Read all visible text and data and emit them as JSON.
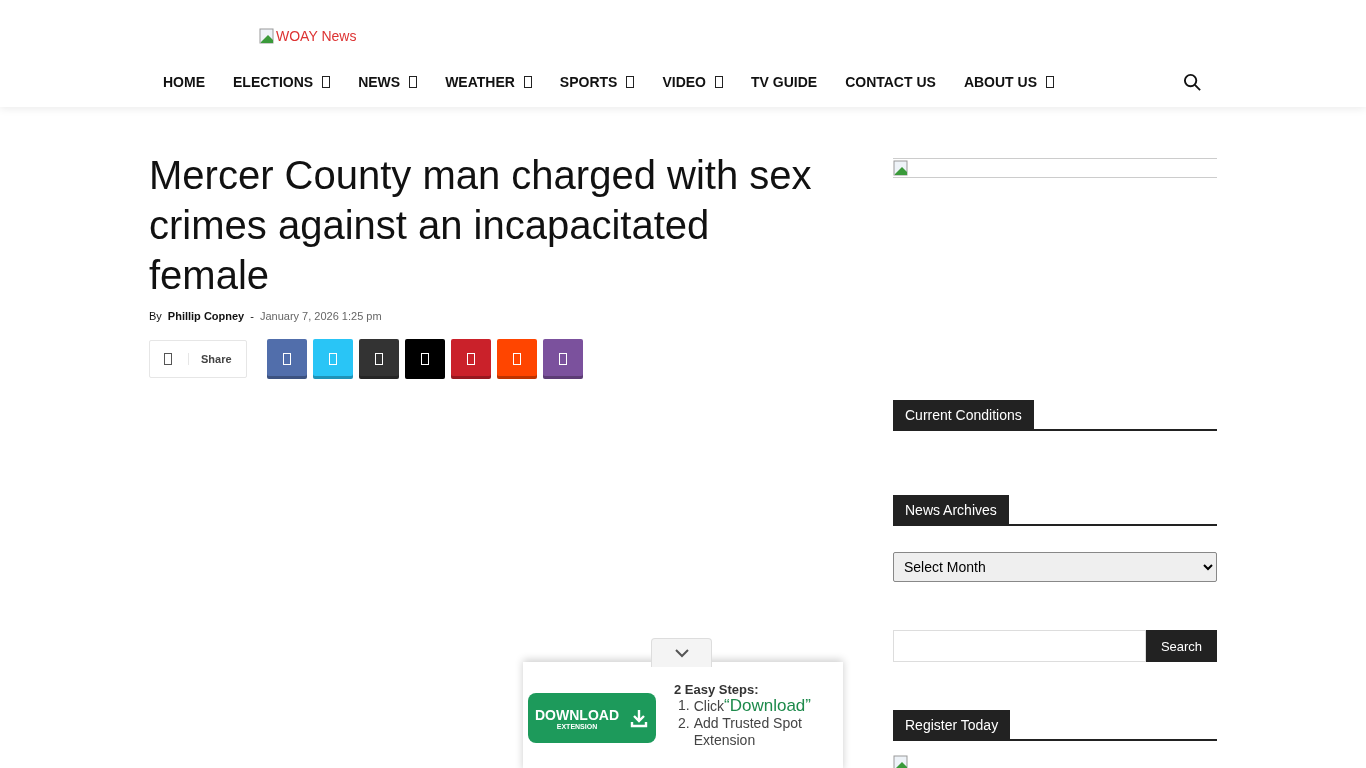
{
  "header": {
    "logo_alt": "WOAY News"
  },
  "nav": [
    {
      "label": "HOME",
      "has_dropdown": false
    },
    {
      "label": "ELECTIONS",
      "has_dropdown": true
    },
    {
      "label": "NEWS",
      "has_dropdown": true
    },
    {
      "label": "WEATHER",
      "has_dropdown": true
    },
    {
      "label": "SPORTS",
      "has_dropdown": true
    },
    {
      "label": "VIDEO",
      "has_dropdown": true
    },
    {
      "label": "TV GUIDE",
      "has_dropdown": false
    },
    {
      "label": "CONTACT US",
      "has_dropdown": false
    },
    {
      "label": "ABOUT US",
      "has_dropdown": true
    }
  ],
  "article": {
    "title": "Mercer County man charged with sex crimes against an incapacitated female",
    "by": "By",
    "author": "Phillip Copney",
    "separator": "-",
    "date": "January 7, 2026 1:25 pm",
    "share_label": "Share",
    "share_buttons": [
      {
        "color": "#516eab"
      },
      {
        "color": "#29c5f6"
      },
      {
        "color": "#333333"
      },
      {
        "color": "#000000"
      },
      {
        "color": "#ca212a"
      },
      {
        "color": "#ff4500"
      },
      {
        "color": "#7b519d"
      }
    ]
  },
  "sidebar": {
    "sections": [
      {
        "kind": "image"
      },
      {
        "kind": "heading",
        "title": "Current Conditions"
      },
      {
        "kind": "heading",
        "title": "News Archives"
      },
      {
        "kind": "select",
        "value": "Select Month"
      },
      {
        "kind": "search",
        "button": "Search"
      },
      {
        "kind": "heading",
        "title": "Register Today"
      },
      {
        "kind": "small-image"
      }
    ]
  },
  "popup": {
    "button": "DOWNLOAD",
    "button_sub": "EXTENSION",
    "steps_title": "2 Easy Steps:",
    "steps": [
      {
        "number": "1.",
        "text": "Click",
        "link": "“Download”"
      },
      {
        "number": "2.",
        "text": "Add Trusted Spot Extension"
      }
    ]
  }
}
